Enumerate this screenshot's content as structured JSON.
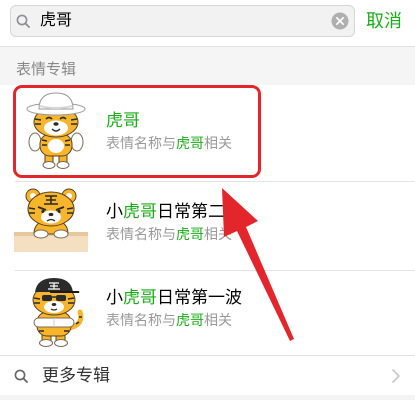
{
  "search": {
    "query": "虎哥",
    "cancel_label": "取消",
    "search_icon": "search-icon",
    "clear_icon": "clear-icon"
  },
  "section": {
    "title": "表情专辑"
  },
  "results": [
    {
      "image": "tiger-sticker-icon",
      "title": [
        {
          "text": "虎哥",
          "highlight": true
        }
      ],
      "subtitle": [
        {
          "text": "表情名称与",
          "highlight": false
        },
        {
          "text": "虎哥",
          "highlight": true
        },
        {
          "text": "相关",
          "highlight": false
        }
      ]
    },
    {
      "image": "tiger-sticker-icon",
      "title": [
        {
          "text": "小",
          "highlight": false
        },
        {
          "text": "虎哥",
          "highlight": true
        },
        {
          "text": "日常第二",
          "highlight": false
        }
      ],
      "subtitle": [
        {
          "text": "表情名称与",
          "highlight": false
        },
        {
          "text": "虎哥",
          "highlight": true
        },
        {
          "text": "相关",
          "highlight": false
        }
      ]
    },
    {
      "image": "tiger-sticker-icon",
      "title": [
        {
          "text": "小",
          "highlight": false
        },
        {
          "text": "虎哥",
          "highlight": true
        },
        {
          "text": "日常第一波",
          "highlight": false
        }
      ],
      "subtitle": [
        {
          "text": "表情名称与",
          "highlight": false
        },
        {
          "text": "虎哥",
          "highlight": true
        },
        {
          "text": "相关",
          "highlight": false
        }
      ]
    }
  ],
  "more": {
    "label": "更多专辑",
    "icon": "search-icon",
    "chevron": "chevron-right-icon"
  },
  "colors": {
    "accent": "#1aad19",
    "title": "#000000",
    "subtitle": "#999999",
    "section_title": "#888888",
    "annotation_red": "#e3262b"
  }
}
